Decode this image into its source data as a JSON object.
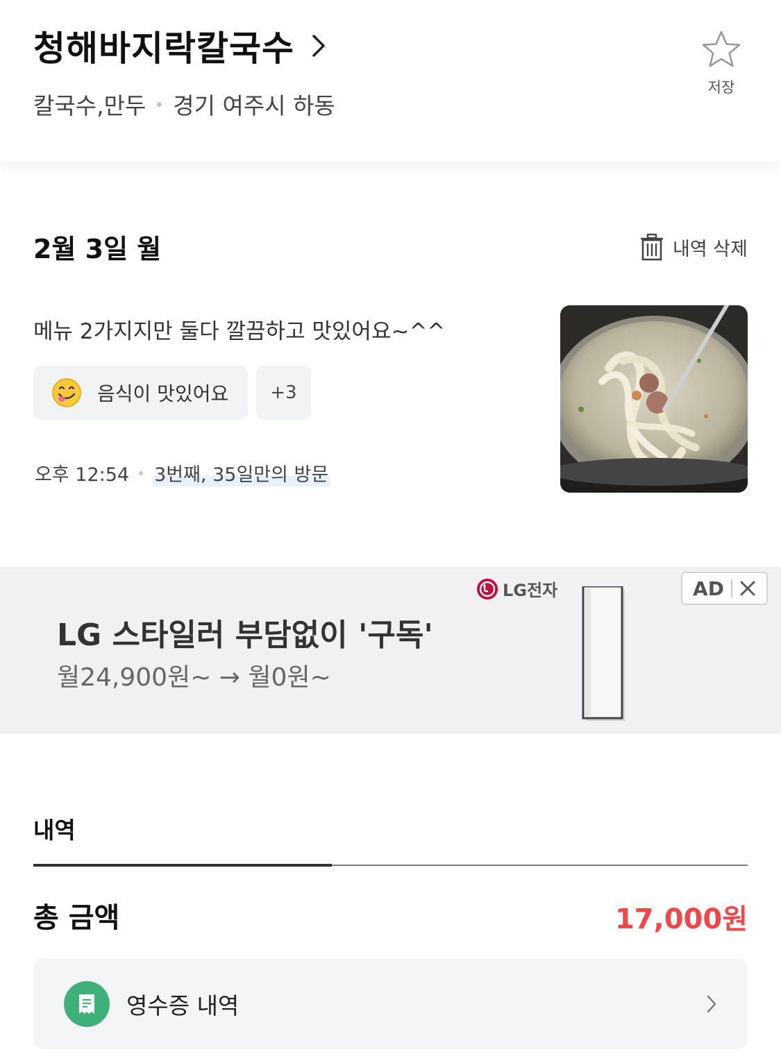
{
  "header": {
    "title": "청해바지락칼국수",
    "category": "칼국수,만두",
    "location": "경기 여주시 하동",
    "save_label": "저장"
  },
  "visit": {
    "date": "2월 3일 월",
    "delete_label": "내역 삭제",
    "review": "메뉴 2가지지만 둘다 깔끔하고 맛있어요~^^",
    "tag_main": "음식이 맛있어요",
    "tag_more": "+3",
    "time": "오후 12:54",
    "visit_count": "3번째, 35일만의 방문"
  },
  "ad": {
    "brand": "LG전자",
    "headline": "LG 스타일러 부담없이 '구독'",
    "subline": "월24,900원~ → 월0원~",
    "badge": "AD"
  },
  "details": {
    "tab_label": "내역",
    "total_label": "총 금액",
    "total_value": "17,000원",
    "receipt_label": "영수증 내역"
  },
  "colors": {
    "accent_price": "#f2474a",
    "receipt_icon": "#3fb07a"
  }
}
